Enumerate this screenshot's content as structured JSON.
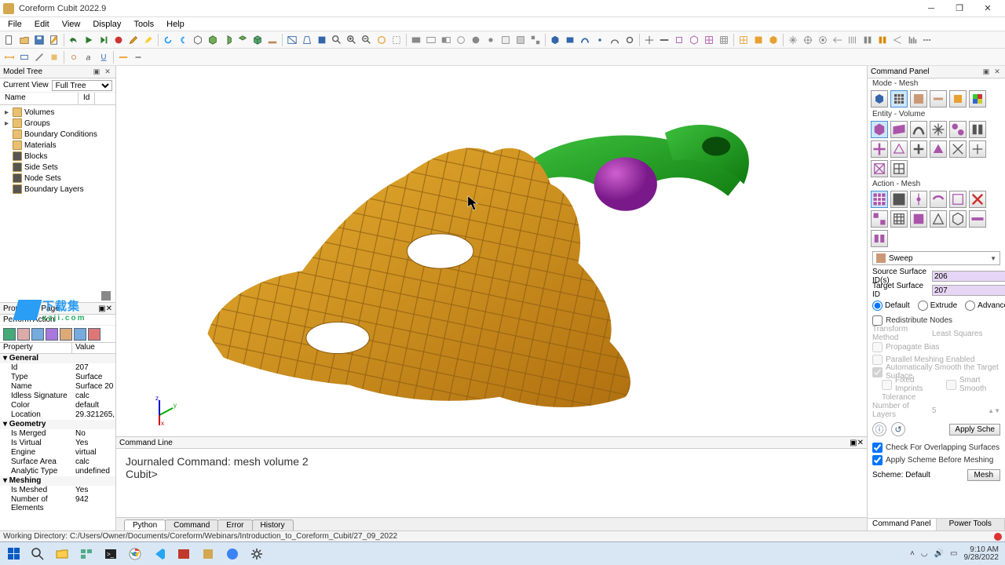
{
  "title": "Coreform Cubit 2022.9",
  "menus": [
    "File",
    "Edit",
    "View",
    "Display",
    "Tools",
    "Help"
  ],
  "left": {
    "modelTree": {
      "title": "Model Tree",
      "currentViewLabel": "Current View",
      "currentView": "Full Tree",
      "columns": [
        "Name",
        "Id"
      ],
      "items": [
        "Volumes",
        "Groups",
        "Boundary Conditions",
        "Materials",
        "Blocks",
        "Side Sets",
        "Node Sets",
        "Boundary Layers"
      ]
    },
    "properties": {
      "title": "Properties Page",
      "perform": "Perform Action",
      "columns": [
        "Property",
        "Value"
      ],
      "groups": [
        {
          "name": "General",
          "rows": [
            [
              "Id",
              "207"
            ],
            [
              "Type",
              "Surface"
            ],
            [
              "Name",
              "Surface 20"
            ],
            [
              "Idless Signature",
              "calc"
            ],
            [
              "Color",
              "default"
            ],
            [
              "Location",
              "29.321265,"
            ]
          ]
        },
        {
          "name": "Geometry",
          "rows": [
            [
              "Is Merged",
              "No"
            ],
            [
              "Is Virtual",
              "Yes"
            ],
            [
              "Engine",
              "virtual"
            ],
            [
              "Surface Area",
              "calc"
            ],
            [
              "Analytic Type",
              "undefined"
            ]
          ]
        },
        {
          "name": "Meshing",
          "rows": [
            [
              "Is Meshed",
              "Yes"
            ],
            [
              "Number of Elements",
              "942"
            ]
          ]
        }
      ]
    },
    "watermark": {
      "line1": "下载集",
      "line2": "xzji.com"
    }
  },
  "center": {
    "commandLine": {
      "title": "Command Line",
      "lines": [
        "Journaled Command: mesh volume 2",
        "",
        "Cubit>"
      ]
    },
    "tabs": [
      "Python",
      "Command",
      "Error",
      "History"
    ],
    "activeTab": 0
  },
  "right": {
    "title": "Command Panel",
    "modeLabel": "Mode - Mesh",
    "entityLabel": "Entity - Volume",
    "actionLabel": "Action - Mesh",
    "scheme": "Sweep",
    "form": {
      "sourceLabel": "Source Surface ID(s)",
      "sourceVal": "206",
      "targetLabel": "Target Surface ID",
      "targetVal": "207",
      "radios": [
        "Default",
        "Extrude",
        "Advanced"
      ],
      "redistribute": "Redistribute Nodes",
      "transformMethod": "Transform Method",
      "transformVal": "Least Squares",
      "propagate": "Propagate Bias",
      "parallel": "Parallel Meshing Enabled",
      "autoSmooth": "Automatically Smooth the Target Surface",
      "fixedImprints": "Fixed Imprints",
      "smartSmooth": "Smart Smooth",
      "tolerance": "Tolerance",
      "numLayersLabel": "Number of Layers",
      "numLayersVal": "5",
      "checkOverlap": "Check For Overlapping Surfaces",
      "applyScheme": "Apply Scheme Before Meshing",
      "schemeLabel": "Scheme: Default",
      "applySche": "Apply Sche",
      "mesh": "Mesh"
    },
    "bottomTabs": [
      "Command Panel",
      "Power Tools"
    ]
  },
  "status": "Working Directory:  C:/Users/Owner/Documents/Coreform/Webinars/Introduction_to_Coreform_Cubit/27_09_2022",
  "taskbar": {
    "time": "9:10 AM",
    "date": "9/28/2022"
  }
}
